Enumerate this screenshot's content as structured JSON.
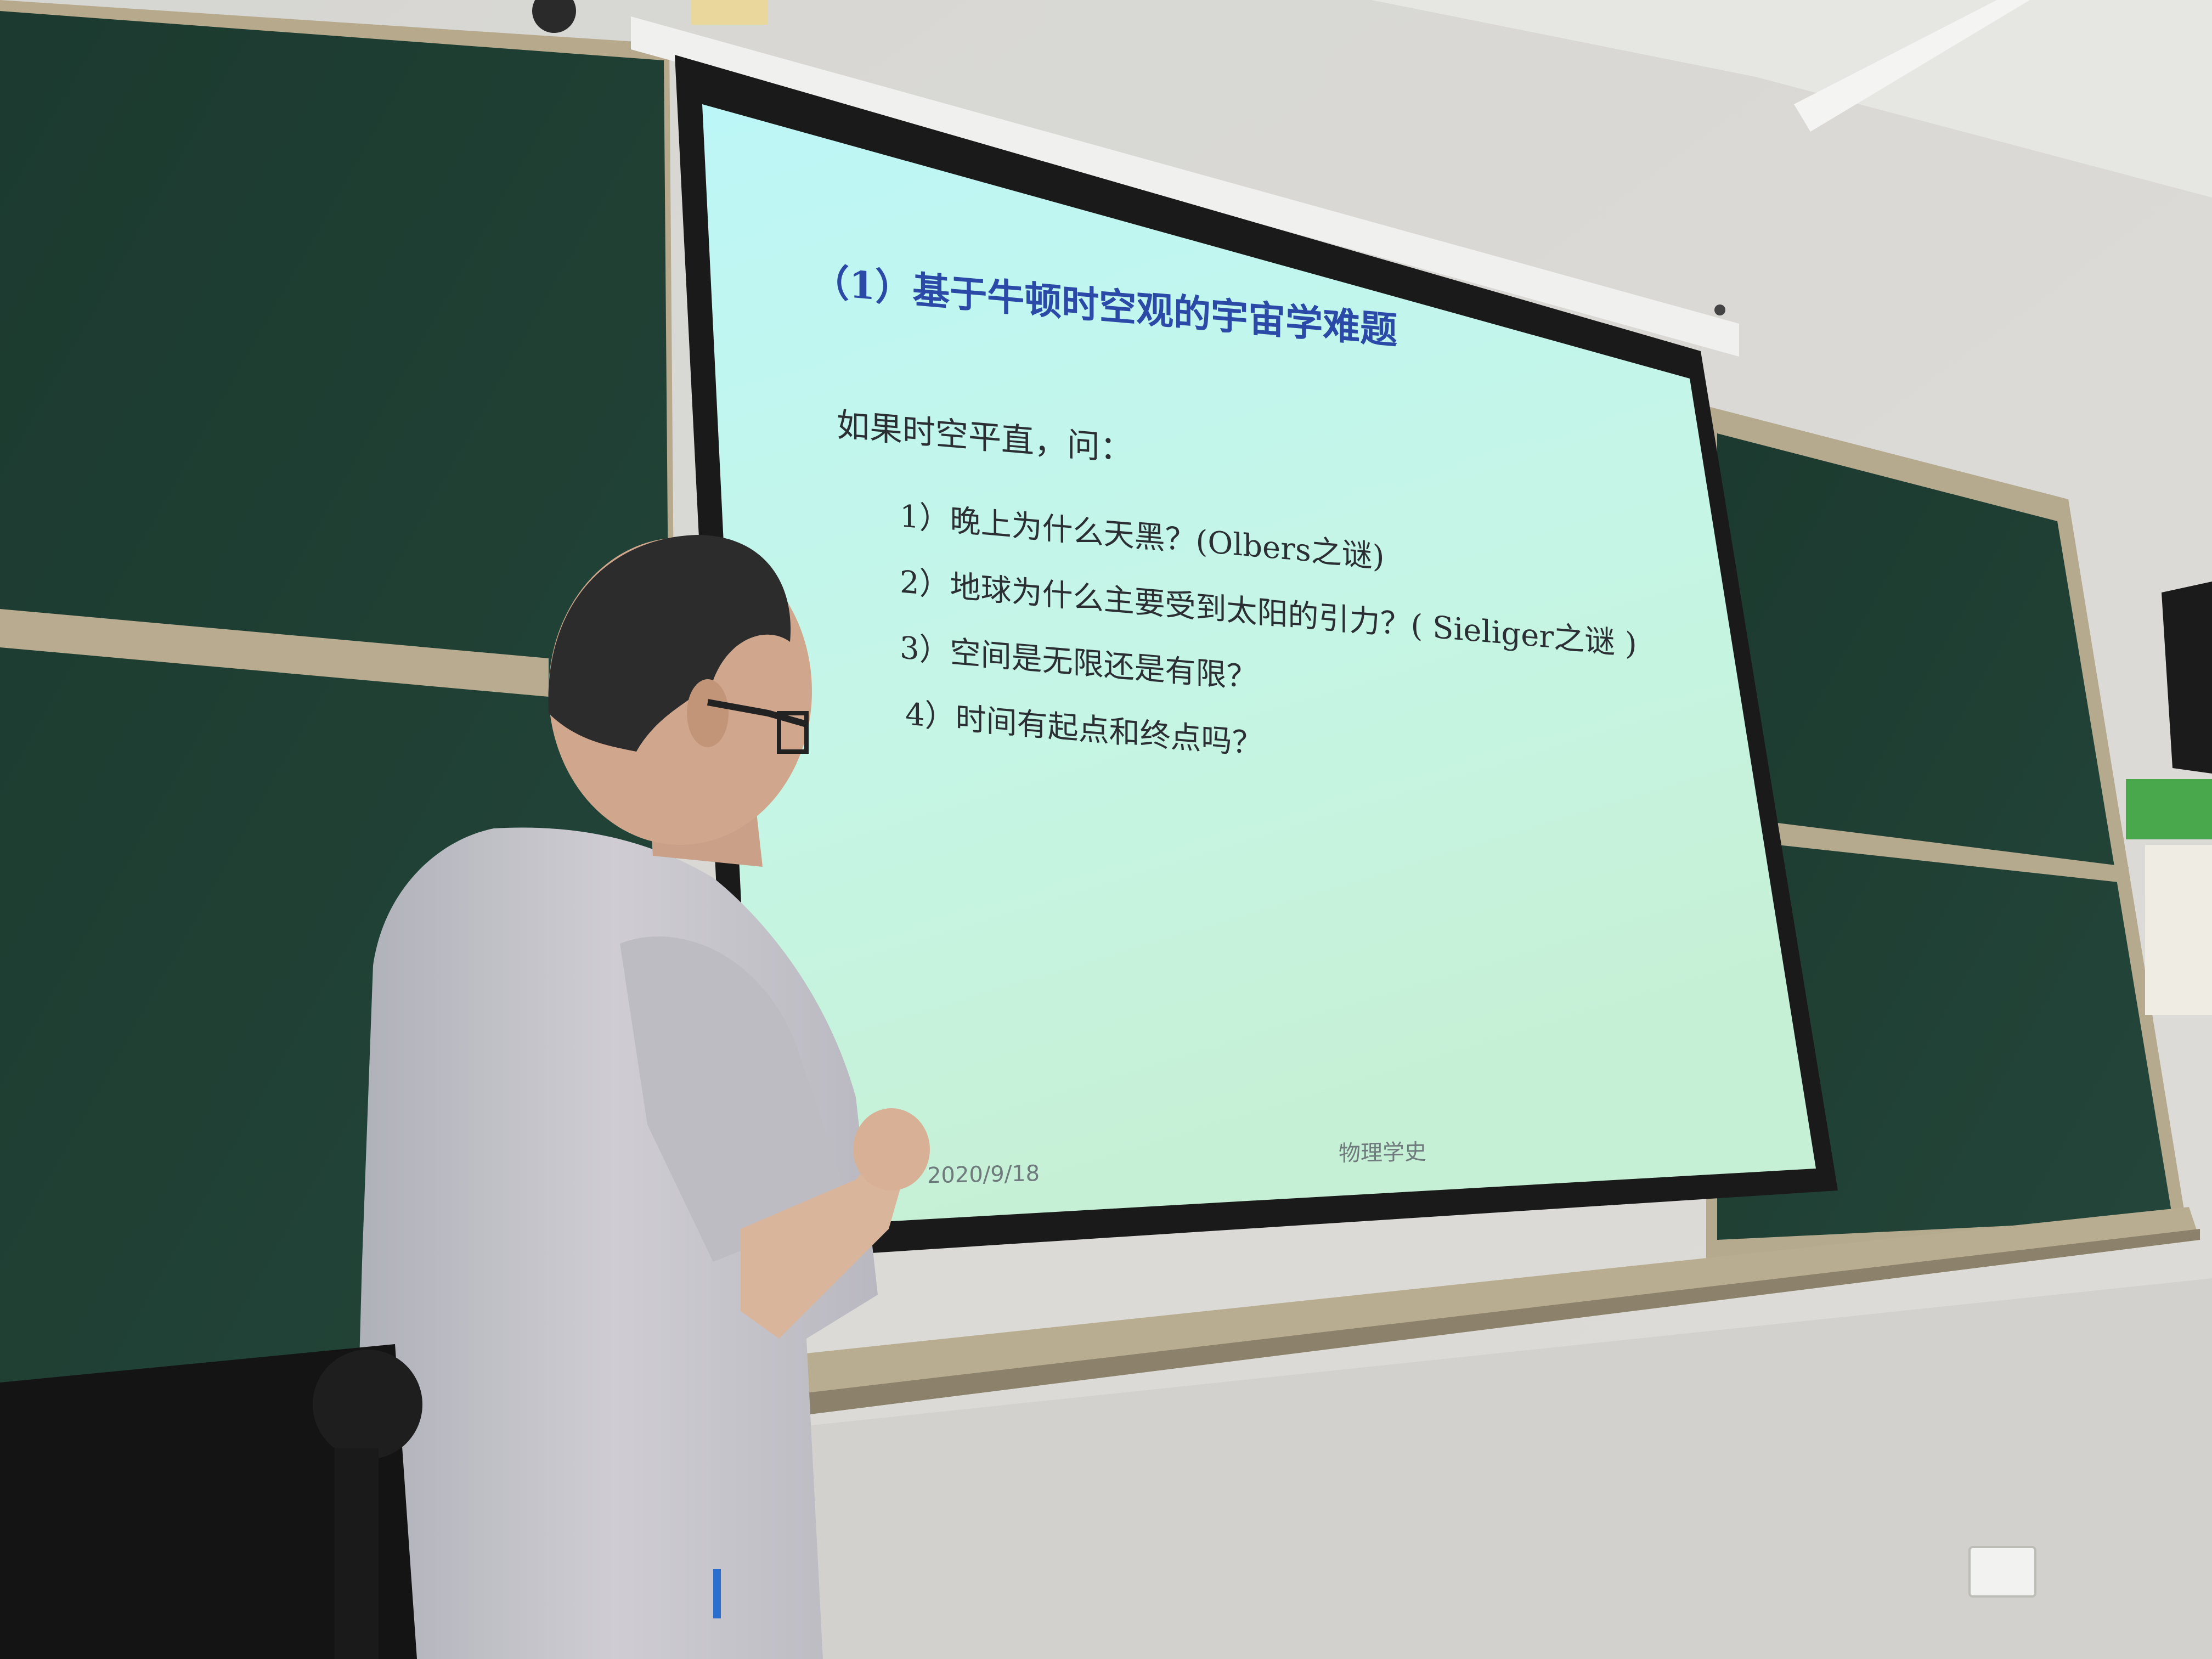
{
  "slide": {
    "title": "（1）基于牛顿时空观的宇宙学难题",
    "intro": "如果时空平直，问：",
    "items": [
      "1）晚上为什么天黑？(Olbers之谜)",
      "2）地球为什么主要受到太阳的引力？( Sieliger之谜 )",
      "3）空间是无限还是有限？",
      "4）时间有起点和终点吗？"
    ],
    "footer_date": "2020/9/18",
    "footer_course": "物理学史"
  },
  "colors": {
    "slide_background_top": "#bff7f6",
    "slide_background_bottom": "#c4f1d8",
    "title_color": "#2b49a6",
    "chalkboard": "#1f3b30",
    "wall": "#d9d9d6",
    "shirt": "#c9c8ce"
  }
}
